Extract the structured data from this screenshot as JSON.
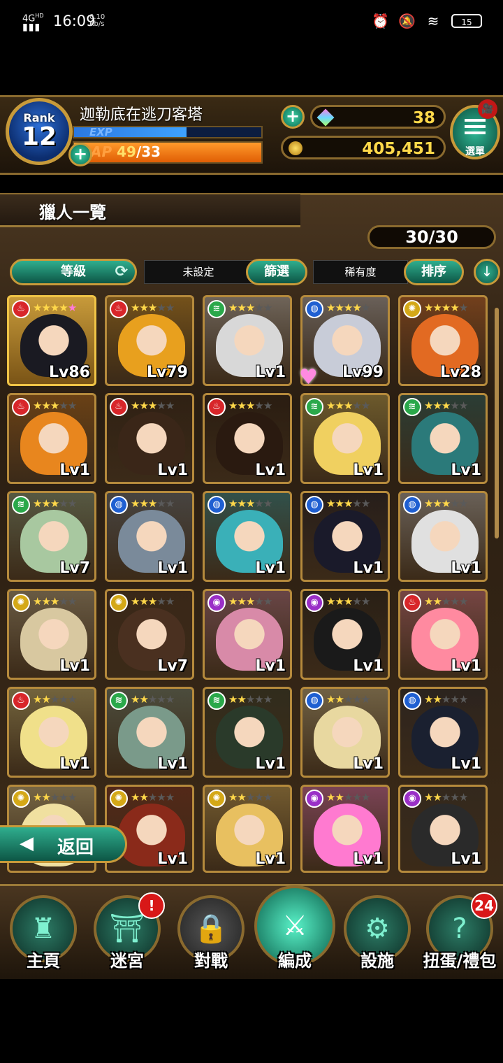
{
  "status_bar": {
    "network": "4G",
    "network_hd": "HD",
    "time": "16:09",
    "speed_value": "0.10",
    "speed_unit": "Kb/s",
    "battery": "15"
  },
  "hud": {
    "rank_label": "Rank",
    "rank_value": "12",
    "player_name": "迦勒底在逃刀客塔",
    "exp_label": "EXP",
    "exp_fill": 0.6,
    "ap_label": "AP",
    "ap_current": "49",
    "ap_max": "/33",
    "ap_fill": 1.0,
    "gems": "38",
    "coins": "405,451",
    "menu_label": "選單"
  },
  "panel": {
    "title": "獵人一覽",
    "count": "30/30",
    "sort_level_label": "等級",
    "filter_value": "未設定",
    "filter_button": "篩選",
    "sort_value": "稀有度",
    "sort_button": "排序",
    "back_label": "返回"
  },
  "elements": {
    "fire": {
      "color": "#d8262a",
      "glyph": "♨"
    },
    "wind": {
      "color": "#2aa84a",
      "glyph": "≋"
    },
    "water": {
      "color": "#1f5fd1",
      "glyph": "◍"
    },
    "light": {
      "color": "#d4a817",
      "glyph": "✺"
    },
    "dark": {
      "color": "#9a2fc7",
      "glyph": "◉"
    }
  },
  "hunters": [
    {
      "element": "fire",
      "stars": 4,
      "extra": "pink",
      "level": "Lv86",
      "hair": "#1a1a22",
      "gold": true
    },
    {
      "element": "fire",
      "stars": 3,
      "level": "Lv79",
      "hair": "#e8a01e"
    },
    {
      "element": "wind",
      "stars": 3,
      "level": "Lv1",
      "hair": "#d8d8d8"
    },
    {
      "element": "water",
      "stars": 4,
      "level": "Lv99",
      "hair": "#c8ccd8"
    },
    {
      "element": "light",
      "stars": 4,
      "level": "Lv28",
      "hair": "#e26a22"
    },
    {
      "element": "fire",
      "stars": 3,
      "level": "Lv1",
      "hair": "#e8861e"
    },
    {
      "element": "fire",
      "stars": 3,
      "level": "Lv1",
      "hair": "#3a2618"
    },
    {
      "element": "fire",
      "stars": 3,
      "level": "Lv1",
      "hair": "#2a1a10"
    },
    {
      "element": "wind",
      "stars": 3,
      "level": "Lv1",
      "hair": "#f0d060"
    },
    {
      "element": "wind",
      "stars": 3,
      "level": "Lv1",
      "hair": "#2b7a7a"
    },
    {
      "element": "wind",
      "stars": 3,
      "level": "Lv7",
      "hair": "#a8c8a0"
    },
    {
      "element": "water",
      "stars": 3,
      "level": "Lv1",
      "hair": "#7a8a9a"
    },
    {
      "element": "water",
      "stars": 3,
      "level": "Lv1",
      "hair": "#3ab0b8"
    },
    {
      "element": "water",
      "stars": 3,
      "level": "Lv1",
      "hair": "#1a1a2a"
    },
    {
      "element": "water",
      "stars": 3,
      "level": "Lv1",
      "hair": "#e0e0e0"
    },
    {
      "element": "light",
      "stars": 3,
      "level": "Lv1",
      "hair": "#d8c8a0"
    },
    {
      "element": "light",
      "stars": 3,
      "level": "Lv7",
      "hair": "#4a3020"
    },
    {
      "element": "dark",
      "stars": 3,
      "level": "Lv1",
      "hair": "#d88aa8"
    },
    {
      "element": "dark",
      "stars": 3,
      "level": "Lv1",
      "hair": "#1a1a1a"
    },
    {
      "element": "fire",
      "stars": 2,
      "level": "Lv1",
      "hair": "#ff8aa0"
    },
    {
      "element": "fire",
      "stars": 2,
      "level": "Lv1",
      "hair": "#f0e08a"
    },
    {
      "element": "wind",
      "stars": 2,
      "level": "Lv1",
      "hair": "#7a9a8a"
    },
    {
      "element": "wind",
      "stars": 2,
      "level": "Lv1",
      "hair": "#2a3a2a"
    },
    {
      "element": "water",
      "stars": 2,
      "level": "Lv1",
      "hair": "#e8d8a0"
    },
    {
      "element": "water",
      "stars": 2,
      "level": "Lv1",
      "hair": "#1a2030"
    },
    {
      "element": "light",
      "stars": 2,
      "level": "",
      "hair": "#f0e0a0"
    },
    {
      "element": "light",
      "stars": 2,
      "level": "Lv1",
      "hair": "#8a2a1a"
    },
    {
      "element": "light",
      "stars": 2,
      "level": "Lv1",
      "hair": "#e8c060"
    },
    {
      "element": "dark",
      "stars": 2,
      "level": "Lv1",
      "hair": "#ff7ad0"
    },
    {
      "element": "dark",
      "stars": 2,
      "level": "Lv1",
      "hair": "#2a2a2a"
    }
  ],
  "nav": [
    {
      "label": "主頁",
      "icon": "castle-icon",
      "glyph": "♜"
    },
    {
      "label": "迷宮",
      "icon": "gate-icon",
      "glyph": "⛩",
      "badge": "!"
    },
    {
      "label": "對戰",
      "icon": "lock-icon",
      "glyph": "🔒",
      "locked": true
    },
    {
      "label": "編成",
      "icon": "team-icon",
      "glyph": "⚔",
      "active": true
    },
    {
      "label": "設施",
      "icon": "gear-icon",
      "glyph": "⚙"
    },
    {
      "label": "扭蛋/禮包",
      "icon": "gacha-icon",
      "glyph": "?",
      "badge": "24"
    }
  ]
}
